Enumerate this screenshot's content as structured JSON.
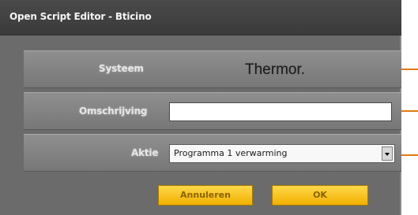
{
  "window": {
    "title": "Open Script Editor - Bticino"
  },
  "rows": {
    "system": {
      "label": "Systeem",
      "value": "Thermor."
    },
    "description": {
      "label": "Omschrijving",
      "value": ""
    },
    "action": {
      "label": "Aktie",
      "selected": "Programma 1 verwarming"
    }
  },
  "buttons": {
    "cancel_label": "Annuleren",
    "ok_label": "OK"
  },
  "colors": {
    "dialog_bg": "#6b6b6b",
    "panel_bg": "#838383",
    "button_yellow": "#f6c21a",
    "connector_orange": "#e07a12"
  }
}
